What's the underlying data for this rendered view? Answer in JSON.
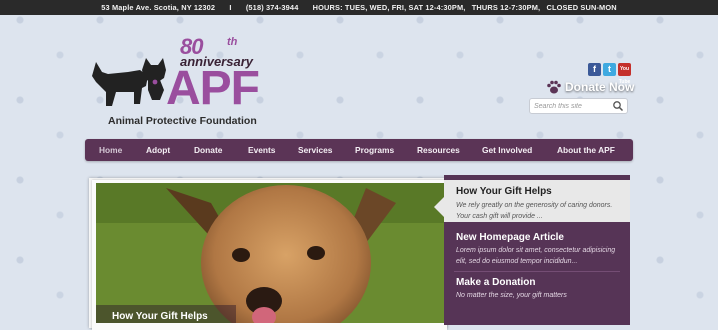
{
  "topbar": {
    "address": "53 Maple Ave. Scotia, NY 12302",
    "sep": "I",
    "phone": "(518) 374-3944",
    "hours": "HOURS: TUES, WED, FRI, SAT 12-4:30PM,",
    "thurs": "THURS 12-7:30PM,",
    "closed": "CLOSED SUN-MON"
  },
  "logo": {
    "anniversary_number": "80",
    "anniversary_suffix": "th",
    "anniversary_word": "anniversary",
    "acronym": "APF",
    "org_name": "Animal Protective Foundation"
  },
  "social": {
    "facebook": "f",
    "twitter": "t",
    "youtube": "You Tube"
  },
  "donate_label": "Donate Now",
  "search": {
    "placeholder": "Search this site"
  },
  "nav": {
    "items": [
      {
        "label": "Home"
      },
      {
        "label": "Adopt"
      },
      {
        "label": "Donate"
      },
      {
        "label": "Events"
      },
      {
        "label": "Services"
      },
      {
        "label": "Programs"
      },
      {
        "label": "Resources"
      },
      {
        "label": "Get Involved"
      },
      {
        "label": "About the APF"
      }
    ]
  },
  "slider": {
    "caption": "How Your Gift Helps",
    "panel": [
      {
        "title": "How Your Gift Helps",
        "desc1": "We rely greatly on the generosity of caring donors.",
        "desc2": "Your cash gift will provide ..."
      },
      {
        "title": "New Homepage Article",
        "desc1": "Lorem ipsum dolor sit amet, consectetur adipisicing",
        "desc2": "elit, sed do eiusmod tempor incididun..."
      },
      {
        "title": "Make a Donation",
        "desc1": "No matter the size, your gift matters",
        "desc2": ""
      }
    ]
  },
  "colors": {
    "brand_purple": "#9a4e9e",
    "nav_bg": "#5b3456",
    "panel_bg": "#563456",
    "topbar": "#2a2a2a"
  }
}
